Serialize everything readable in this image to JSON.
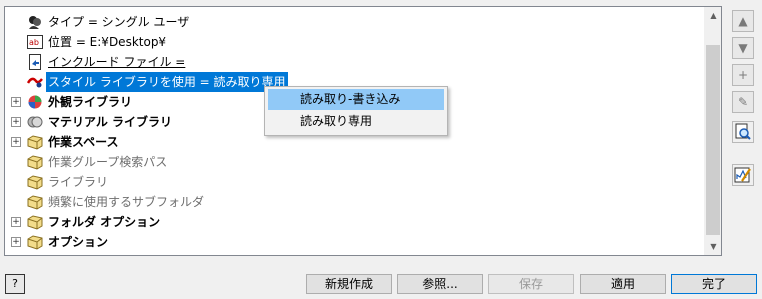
{
  "tree": {
    "rows": [
      {
        "label": "タイプ = シングル ユーザ",
        "icon": "user-icon"
      },
      {
        "label": "位置 = E:¥Desktop¥",
        "icon": "text-field-icon"
      },
      {
        "label": "インクルード ファイル = ",
        "icon": "include-file-icon"
      },
      {
        "label": "スタイル ライブラリを使用 = 読み取り専用",
        "icon": "style-library-icon"
      },
      {
        "label": "外観ライブラリ",
        "icon": "appearance-library-icon"
      },
      {
        "label": "マテリアル ライブラリ",
        "icon": "material-library-icon"
      },
      {
        "label": "作業スペース",
        "icon": "folder-icon"
      },
      {
        "label": "作業グループ検索パス",
        "icon": "folder-icon"
      },
      {
        "label": "ライブラリ",
        "icon": "folder-icon"
      },
      {
        "label": "頻繁に使用するサブフォルダ",
        "icon": "folder-icon"
      },
      {
        "label": "フォルダ オプション",
        "icon": "folder-icon"
      },
      {
        "label": "オプション",
        "icon": "folder-icon"
      }
    ],
    "expander_symbol": "+"
  },
  "context_menu": {
    "items": [
      "読み取り-書き込み",
      "読み取り専用"
    ]
  },
  "side_toolbar": {
    "move_up": "▲",
    "move_down": "▼",
    "add": "+",
    "edit": "✎"
  },
  "scrollbar": {
    "up": "▲",
    "down": "▼"
  },
  "footer": {
    "help": "?",
    "new_label": "新規作成",
    "browse_label": "参照...",
    "save_label": "保存",
    "apply_label": "適用",
    "done_label": "完了"
  },
  "colors": {
    "selection": "#0078d7",
    "menu_highlight": "#91c9f7"
  }
}
